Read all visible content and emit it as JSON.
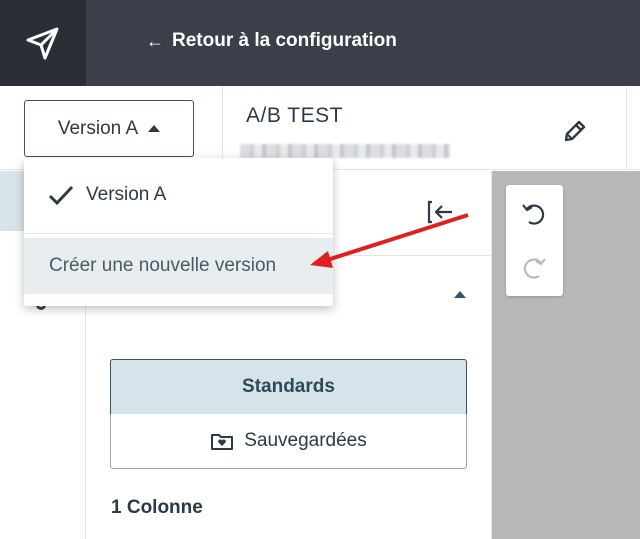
{
  "topbar": {
    "logo_icon": "paper-plane-icon",
    "back_arrow": "←",
    "back_label": "Retour à la configuration"
  },
  "header": {
    "version_button_label": "Version A",
    "title": "A/B TEST",
    "edit_icon": "pencil-icon"
  },
  "dropdown": {
    "items": [
      {
        "label": "Version A",
        "checked": true
      },
      {
        "label": "Créer une nouvelle version",
        "highlighted": true
      }
    ]
  },
  "panel": {
    "tabs": [
      {
        "label": "Standards",
        "active": true
      },
      {
        "label": "Sauvegardées",
        "icon": "folder-heart-icon"
      }
    ],
    "section_label": "1 Colonne"
  },
  "tools": {
    "undo_icon": "undo-icon",
    "redo_icon": "redo-icon"
  },
  "colors": {
    "topbar_bg": "#3a3f4a",
    "logo_bg": "#2a2e37",
    "accent_border": "#3a5564",
    "active_tab_bg": "#d6e3ea",
    "canvas_bg": "#b8b8b8",
    "annotation": "#e02020"
  }
}
